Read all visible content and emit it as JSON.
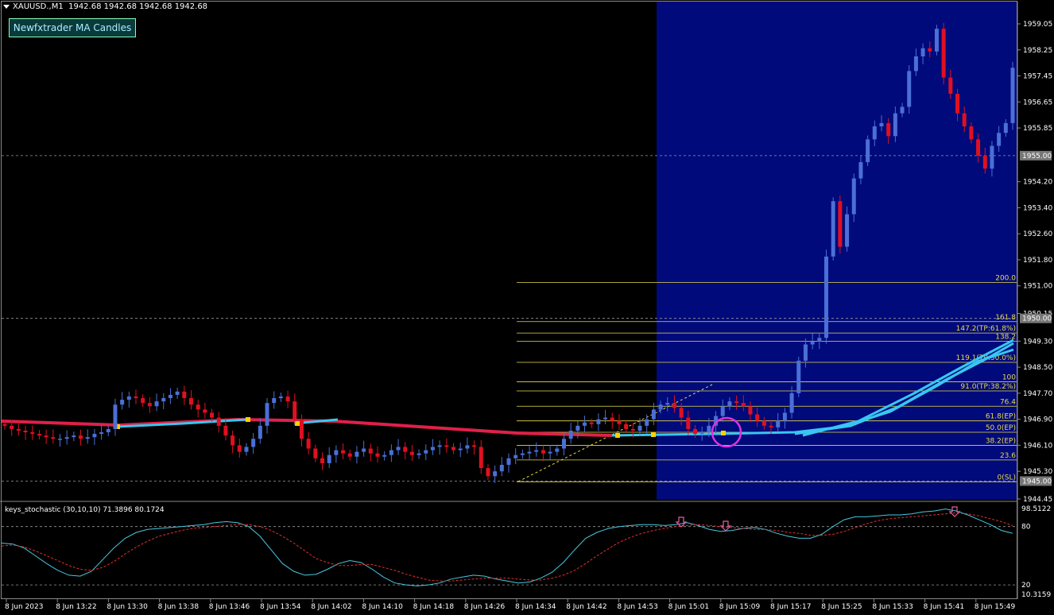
{
  "header": {
    "symbol": "XAUUSD.,M1",
    "ohlc": "1942.68 1942.68 1942.68 1942.68"
  },
  "ma_button": {
    "label": "Newfxtrader MA Candles"
  },
  "colors": {
    "background": "#000000",
    "highlight_zone": "#000a7a",
    "bull_candle": "#4b6fd6",
    "bear_candle": "#e01020",
    "ma_red": "#e0204a",
    "ma_cyan": "#39c6f0",
    "fib_line": "#e8d94a",
    "marker_circle": "#e030e0",
    "stoch_main": "#46c8e0",
    "stoch_signal": "#e03030",
    "arrow": "#e060a0"
  },
  "price_axis": {
    "labels": [
      "1959.05",
      "1958.25",
      "1957.45",
      "1956.65",
      "1955.85",
      "1954.20",
      "1953.40",
      "1952.60",
      "1951.80",
      "1951.00",
      "1950.15",
      "1949.30",
      "1948.50",
      "1947.70",
      "1946.90",
      "1946.10",
      "1945.30",
      "1944.45"
    ],
    "highlight_labels": [
      "1955.00",
      "1950.00",
      "1945.00"
    ]
  },
  "time_axis": {
    "labels": [
      "8 Jun 2023",
      "8 Jun 13:22",
      "8 Jun 13:30",
      "8 Jun 13:38",
      "8 Jun 13:46",
      "8 Jun 13:54",
      "8 Jun 14:02",
      "8 Jun 14:10",
      "8 Jun 14:18",
      "8 Jun 14:26",
      "8 Jun 14:34",
      "8 Jun 14:42",
      "8 Jun 14:53",
      "8 Jun 15:01",
      "8 Jun 15:09",
      "8 Jun 15:17",
      "8 Jun 15:25",
      "8 Jun 15:33",
      "8 Jun 15:41",
      "8 Jun 15:49"
    ]
  },
  "fib_levels": [
    {
      "label": "200.0",
      "price": 1951.1
    },
    {
      "label": "161.8",
      "price": 1949.9
    },
    {
      "label": "147.2(TP:61.8%)",
      "price": 1949.55
    },
    {
      "label": "138.2",
      "price": 1949.3
    },
    {
      "label": "119.1(TP:50.0%)",
      "price": 1948.65
    },
    {
      "label": "100",
      "price": 1948.05
    },
    {
      "label": "91.0(TP:38.2%)",
      "price": 1947.77
    },
    {
      "label": "76.4",
      "price": 1947.3
    },
    {
      "label": "61.8(EP)",
      "price": 1946.85
    },
    {
      "label": "50.0(EP)",
      "price": 1946.5
    },
    {
      "label": "38.2(EP)",
      "price": 1946.1
    },
    {
      "label": "23.6",
      "price": 1945.65
    },
    {
      "label": "0(SL)",
      "price": 1944.98
    }
  ],
  "stochastic": {
    "title": "keys_stochastic (30,10,10) 71.3896 80.1724",
    "axis_labels": [
      "98.5122",
      "80",
      "20",
      "10.3159"
    ]
  },
  "chart_data": [
    {
      "type": "candlestick",
      "title": "XAUUSD.,M1",
      "ylim": [
        1944.45,
        1959.6
      ],
      "grid": false,
      "price_levels_dashed": [
        1955.0,
        1950.0,
        1945.0
      ],
      "x_labels": [
        "8 Jun 2023",
        "8 Jun 13:22",
        "8 Jun 13:30",
        "8 Jun 13:38",
        "8 Jun 13:46",
        "8 Jun 13:54",
        "8 Jun 14:02",
        "8 Jun 14:10",
        "8 Jun 14:18",
        "8 Jun 14:26",
        "8 Jun 14:34",
        "8 Jun 14:42",
        "8 Jun 14:53",
        "8 Jun 15:01",
        "8 Jun 15:09",
        "8 Jun 15:17",
        "8 Jun 15:25",
        "8 Jun 15:33",
        "8 Jun 15:41",
        "8 Jun 15:49"
      ],
      "closes": [
        1946.7,
        1946.6,
        1946.55,
        1946.5,
        1946.45,
        1946.4,
        1946.35,
        1946.3,
        1946.3,
        1946.35,
        1946.4,
        1946.3,
        1946.35,
        1946.45,
        1946.5,
        1946.6,
        1947.35,
        1947.5,
        1947.6,
        1947.55,
        1947.4,
        1947.3,
        1947.45,
        1947.55,
        1947.65,
        1947.75,
        1947.55,
        1947.35,
        1947.2,
        1947.1,
        1946.95,
        1946.7,
        1946.4,
        1946.1,
        1945.9,
        1946.05,
        1946.3,
        1946.7,
        1947.4,
        1947.55,
        1947.6,
        1947.45,
        1946.9,
        1946.3,
        1946.0,
        1945.7,
        1945.55,
        1945.8,
        1945.95,
        1945.85,
        1945.75,
        1945.9,
        1946.0,
        1945.85,
        1945.75,
        1945.8,
        1945.95,
        1946.05,
        1945.9,
        1945.8,
        1945.85,
        1945.95,
        1946.05,
        1946.1,
        1946.05,
        1945.95,
        1946.0,
        1946.1,
        1946.05,
        1945.4,
        1945.15,
        1945.3,
        1945.5,
        1945.7,
        1945.8,
        1945.85,
        1945.9,
        1945.95,
        1945.85,
        1945.9,
        1946.0,
        1946.3,
        1946.55,
        1946.7,
        1946.8,
        1946.75,
        1946.9,
        1946.95,
        1946.85,
        1946.75,
        1946.6,
        1946.55,
        1946.7,
        1946.9,
        1947.2,
        1947.35,
        1947.4,
        1947.25,
        1946.95,
        1946.6,
        1946.45,
        1946.5,
        1946.7,
        1947.0,
        1947.3,
        1947.45,
        1947.4,
        1947.3,
        1947.05,
        1946.85,
        1946.7,
        1946.65,
        1946.85,
        1947.1,
        1947.7,
        1948.7,
        1949.2,
        1949.3,
        1949.4,
        1951.9,
        1953.6,
        1952.2,
        1953.2,
        1954.3,
        1954.8,
        1955.5,
        1955.9,
        1956.0,
        1955.6,
        1956.3,
        1956.5,
        1957.6,
        1958.05,
        1958.3,
        1958.2,
        1958.9,
        1957.4,
        1956.9,
        1956.3,
        1955.9,
        1955.5,
        1955.0,
        1954.6,
        1955.3,
        1955.7,
        1956.0,
        1957.7
      ]
    },
    {
      "type": "line",
      "title": "keys_stochastic (30,10,10)",
      "ylim": [
        10.3159,
        98.5122
      ],
      "levels": [
        80,
        20
      ],
      "series": [
        {
          "name": "main",
          "values": [
            63,
            62,
            58,
            50,
            42,
            35,
            30,
            29,
            34,
            46,
            58,
            68,
            74,
            77,
            78,
            79,
            80,
            81,
            82,
            84,
            85,
            84,
            80,
            70,
            56,
            42,
            34,
            30,
            31,
            36,
            42,
            45,
            43,
            36,
            28,
            22,
            20,
            19,
            20,
            22,
            26,
            28,
            30,
            29,
            26,
            24,
            22,
            23,
            27,
            33,
            43,
            56,
            68,
            74,
            78,
            80,
            81,
            82,
            82,
            81,
            82,
            84,
            81,
            77,
            75,
            76,
            78,
            79,
            77,
            73,
            70,
            68,
            68,
            72,
            80,
            87,
            90,
            90,
            91,
            92,
            92,
            93,
            95,
            96,
            98,
            96,
            92,
            87,
            82,
            76,
            73
          ]
        },
        {
          "name": "signal",
          "values": [
            60,
            61,
            59,
            55,
            50,
            45,
            40,
            36,
            35,
            38,
            44,
            52,
            59,
            65,
            70,
            73,
            76,
            78,
            79,
            80,
            81,
            82,
            82,
            80,
            76,
            70,
            63,
            55,
            47,
            43,
            40,
            40,
            41,
            41,
            38,
            35,
            31,
            28,
            25,
            24,
            24,
            25,
            26,
            27,
            27,
            27,
            26,
            25,
            25,
            27,
            30,
            35,
            42,
            50,
            57,
            64,
            69,
            73,
            76,
            78,
            80,
            81,
            82,
            81,
            80,
            79,
            78,
            77,
            77,
            76,
            74,
            73,
            71,
            71,
            72,
            75,
            79,
            83,
            86,
            88,
            89,
            90,
            91,
            92,
            93,
            94,
            93,
            91,
            88,
            85,
            81
          ]
        }
      ]
    }
  ]
}
